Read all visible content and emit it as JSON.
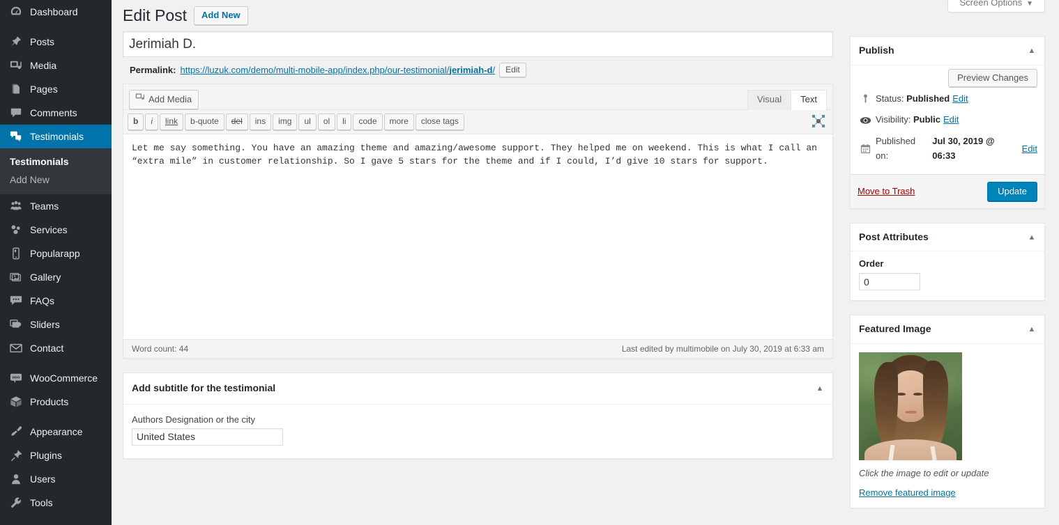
{
  "screen_meta": {
    "label": "Screen Options",
    "caret": "▼"
  },
  "sidebar": {
    "items": [
      {
        "label": "Dashboard",
        "icon": "dashboard-icon",
        "current": false
      },
      {
        "sep": true
      },
      {
        "label": "Posts",
        "icon": "pin-icon",
        "current": false
      },
      {
        "label": "Media",
        "icon": "media-icon",
        "current": false
      },
      {
        "label": "Pages",
        "icon": "pages-icon",
        "current": false
      },
      {
        "label": "Comments",
        "icon": "comment-icon",
        "current": false
      },
      {
        "label": "Testimonials",
        "icon": "testimonials-icon",
        "current": true
      },
      {
        "label": "Teams",
        "icon": "teams-icon",
        "current": false
      },
      {
        "label": "Services",
        "icon": "services-icon",
        "current": false
      },
      {
        "label": "Popularapp",
        "icon": "mobile-icon",
        "current": false
      },
      {
        "label": "Gallery",
        "icon": "gallery-icon",
        "current": false
      },
      {
        "label": "FAQs",
        "icon": "faq-icon",
        "current": false
      },
      {
        "label": "Sliders",
        "icon": "sliders-icon",
        "current": false
      },
      {
        "label": "Contact",
        "icon": "envelope-icon",
        "current": false
      },
      {
        "sep": true
      },
      {
        "label": "WooCommerce",
        "icon": "woocommerce-icon",
        "current": false
      },
      {
        "label": "Products",
        "icon": "products-icon",
        "current": false
      },
      {
        "sep": true
      },
      {
        "label": "Appearance",
        "icon": "appearance-icon",
        "current": false
      },
      {
        "label": "Plugins",
        "icon": "plugins-icon",
        "current": false
      },
      {
        "label": "Users",
        "icon": "users-icon",
        "current": false
      },
      {
        "label": "Tools",
        "icon": "tools-icon",
        "current": false
      }
    ],
    "submenu": [
      {
        "label": "Testimonials",
        "current": true
      },
      {
        "label": "Add New",
        "current": false
      }
    ]
  },
  "header": {
    "title": "Edit Post",
    "add_new_label": "Add New"
  },
  "title_field": {
    "value": "Jerimiah D."
  },
  "permalink": {
    "label": "Permalink:",
    "url_prefix": "https://luzuk.com/demo/multi-mobile-app/index.php/our-testimonial/",
    "slug": "jerimiah-d",
    "url_suffix": "/",
    "edit_label": "Edit"
  },
  "editor": {
    "add_media_label": "Add Media",
    "tabs": [
      {
        "label": "Visual",
        "active": false
      },
      {
        "label": "Text",
        "active": true
      }
    ],
    "quicktags": [
      {
        "label": "b",
        "style": "qt-b"
      },
      {
        "label": "i",
        "style": "qt-i"
      },
      {
        "label": "link",
        "style": "qt-link"
      },
      {
        "label": "b-quote",
        "style": ""
      },
      {
        "label": "del",
        "style": "qt-del"
      },
      {
        "label": "ins",
        "style": ""
      },
      {
        "label": "img",
        "style": ""
      },
      {
        "label": "ul",
        "style": ""
      },
      {
        "label": "ol",
        "style": ""
      },
      {
        "label": "li",
        "style": ""
      },
      {
        "label": "code",
        "style": ""
      },
      {
        "label": "more",
        "style": ""
      },
      {
        "label": "close tags",
        "style": ""
      }
    ],
    "dfw_icon": "fullscreen-expand-icon",
    "content": "Let me say something. You have an amazing theme and amazing/awesome support. They helped me on weekend. This is what I call an “extra mile” in customer relationship. So I gave 5 stars for the theme and if I could, I’d give 10 stars for support.",
    "word_count": "Word count: 44",
    "last_edited": "Last edited by multimobile on July 30, 2019 at 6:33 am"
  },
  "subtitle_box": {
    "title": "Add subtitle for the testimonial",
    "field_label": "Authors Designation or the city",
    "field_value": "United States"
  },
  "publish_box": {
    "title": "Publish",
    "preview_label": "Preview Changes",
    "status_label": "Status:",
    "status_value": "Published",
    "status_edit": "Edit",
    "visibility_label": "Visibility:",
    "visibility_value": "Public",
    "visibility_edit": "Edit",
    "published_label": "Published on:",
    "published_value": "Jul 30, 2019 @ 06:33",
    "published_edit": "Edit",
    "trash_label": "Move to Trash",
    "update_label": "Update"
  },
  "post_attributes": {
    "title": "Post Attributes",
    "order_label": "Order",
    "order_value": "0"
  },
  "featured_image": {
    "title": "Featured Image",
    "caption": "Click the image to edit or update",
    "remove_label": "Remove featured image"
  },
  "colors": {
    "wp_blue": "#0073aa",
    "button_primary": "#0085ba",
    "sidebar_bg": "#23282d",
    "submenu_bg": "#32373c",
    "trash_red": "#a00"
  }
}
